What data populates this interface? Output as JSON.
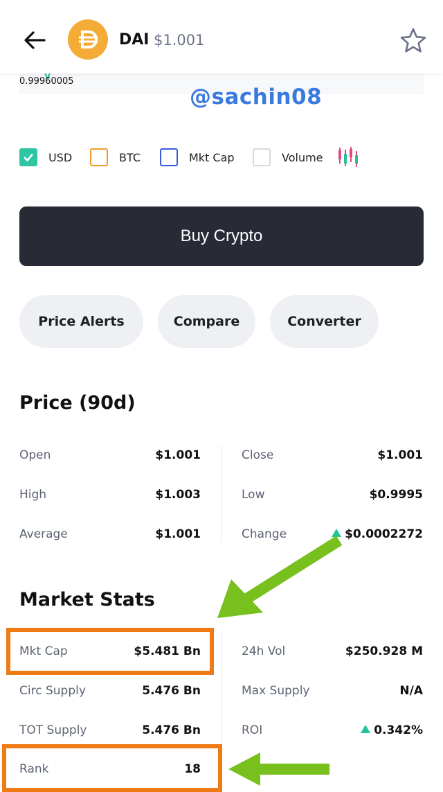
{
  "header": {
    "coin_symbol": "DAI",
    "coin_price": "$1.001"
  },
  "chart": {
    "last_value": "0.99960005",
    "watermark": "@sachin08"
  },
  "legend": [
    {
      "label": "USD",
      "checked": true,
      "color": "#2fc5a2"
    },
    {
      "label": "BTC",
      "checked": false,
      "color": "#ef9a2d"
    },
    {
      "label": "Mkt Cap",
      "checked": false,
      "color": "#3b5bdb"
    },
    {
      "label": "Volume",
      "checked": false,
      "color": "#cfd3d8"
    }
  ],
  "buy": {
    "label": "Buy Crypto"
  },
  "actions": [
    {
      "label": "Price Alerts"
    },
    {
      "label": "Compare"
    },
    {
      "label": "Converter"
    }
  ],
  "price": {
    "title": "Price (90d)",
    "rows": [
      {
        "k1": "Open",
        "v1": "$1.001",
        "k2": "Close",
        "v2": "$1.001"
      },
      {
        "k1": "High",
        "v1": "$1.003",
        "k2": "Low",
        "v2": "$0.9995"
      },
      {
        "k1": "Average",
        "v1": "$1.001",
        "k2": "Change",
        "v2": "$0.0002272"
      }
    ]
  },
  "stats": {
    "title": "Market Stats",
    "rows": [
      {
        "k1": "Mkt Cap",
        "v1": "$5.481 Bn",
        "k2": "24h Vol",
        "v2": "$250.928 M"
      },
      {
        "k1": "Circ Supply",
        "v1": "5.476 Bn",
        "k2": "Max Supply",
        "v2": "N/A"
      },
      {
        "k1": "TOT Supply",
        "v1": "5.476 Bn",
        "k2": "ROI",
        "v2": "0.342%"
      },
      {
        "k1": "Rank",
        "v1": "18"
      }
    ]
  },
  "colors": {
    "accent_up": "#20c39b",
    "highlight": "#ee7b16",
    "arrow": "#78c01d",
    "coin": "#f5ac37"
  }
}
